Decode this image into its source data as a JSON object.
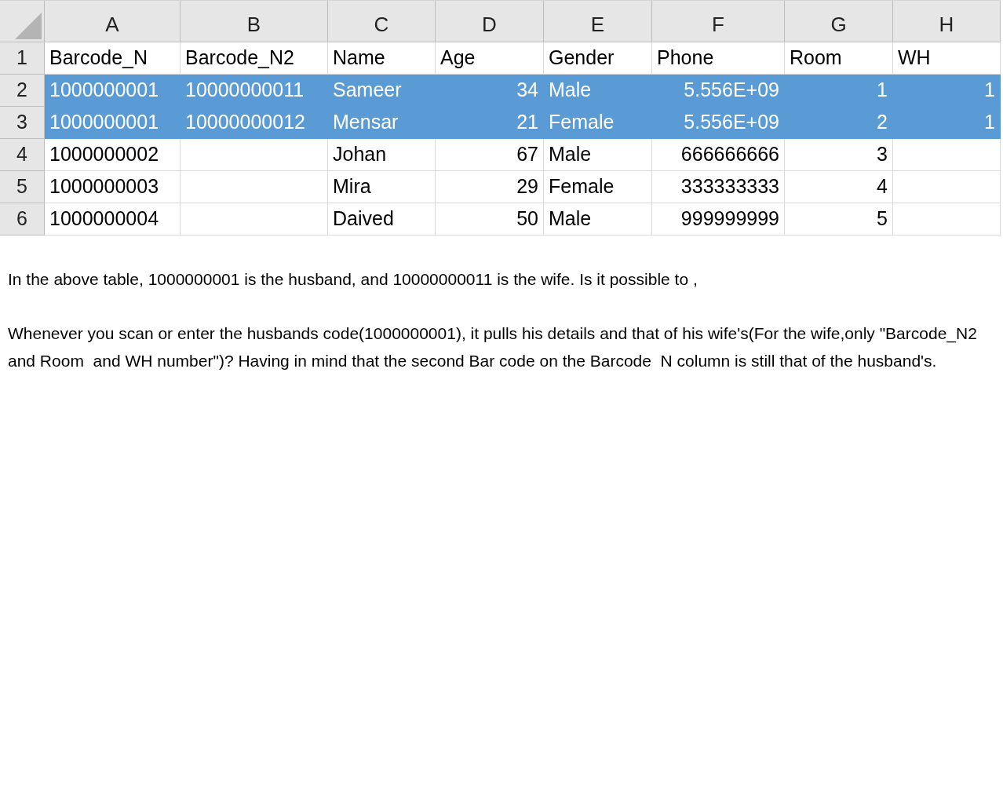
{
  "sheet": {
    "columns": [
      {
        "letter": "A",
        "kind": "text"
      },
      {
        "letter": "B",
        "kind": "text"
      },
      {
        "letter": "C",
        "kind": "text"
      },
      {
        "letter": "D",
        "kind": "number"
      },
      {
        "letter": "E",
        "kind": "text"
      },
      {
        "letter": "F",
        "kind": "number"
      },
      {
        "letter": "G",
        "kind": "number"
      },
      {
        "letter": "H",
        "kind": "number"
      }
    ],
    "rows": [
      {
        "number": "1",
        "selected": false,
        "cells": [
          "Barcode_N",
          "Barcode_N2",
          "Name",
          "Age",
          "Gender",
          "Phone",
          "Room",
          "WH"
        ]
      },
      {
        "number": "2",
        "selected": true,
        "cells": [
          "1000000001",
          "10000000011",
          "Sameer",
          "34",
          "Male",
          "5.556E+09",
          "1",
          "1"
        ]
      },
      {
        "number": "3",
        "selected": true,
        "cells": [
          "1000000001",
          "10000000012",
          "Mensar",
          "21",
          "Female",
          "5.556E+09",
          "2",
          "1"
        ]
      },
      {
        "number": "4",
        "selected": false,
        "cells": [
          "1000000002",
          "",
          "Johan",
          "67",
          "Male",
          "666666666",
          "3",
          ""
        ]
      },
      {
        "number": "5",
        "selected": false,
        "cells": [
          "1000000003",
          "",
          "Mira",
          "29",
          "Female",
          "333333333",
          "4",
          ""
        ]
      },
      {
        "number": "6",
        "selected": false,
        "cells": [
          "1000000004",
          "",
          "Daived",
          "50",
          "Male",
          "999999999",
          "5",
          ""
        ]
      }
    ]
  },
  "paragraphs": [
    "In the above table, 1000000001 is the husband, and 10000000011 is the wife. Is it possible to ,",
    "Whenever you scan or enter the husbands code(1000000001), it pulls his details and that of his wife's(For the wife,only \"Barcode_N2 and Room  and WH number\")? Having in mind that the second Bar code on the Barcode  N column is still that of the husband's."
  ]
}
